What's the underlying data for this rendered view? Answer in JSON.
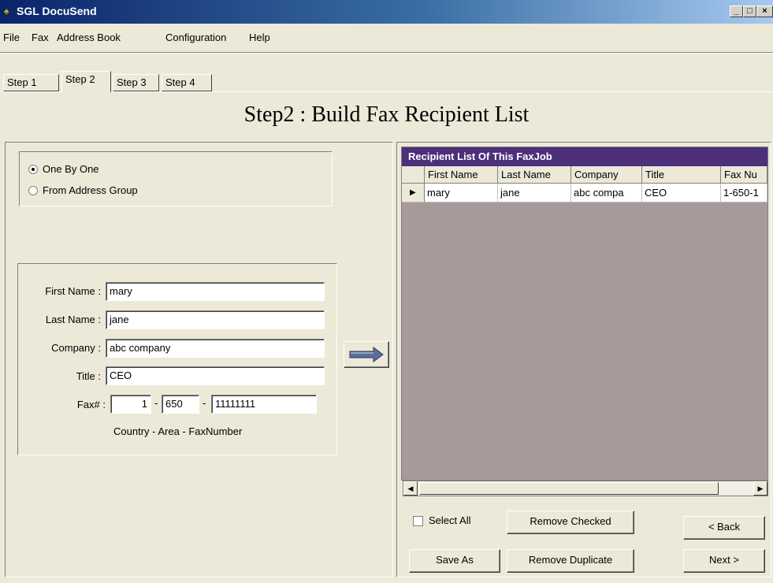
{
  "window": {
    "title": "SGL DocuSend",
    "minimize": "_",
    "maximize": "□",
    "close": "×"
  },
  "menu": [
    "File",
    "Fax",
    "Address Book",
    "Configuration",
    "Help"
  ],
  "tabs": [
    "Step 1",
    "Step 2",
    "Step 3",
    "Step 4"
  ],
  "heading": "Step2 : Build Fax Recipient List",
  "mode": {
    "one_by_one": "One By One",
    "from_group": "From Address Group",
    "selected": "One By One"
  },
  "form": {
    "first_name_label": "First Name :",
    "first_name": "mary",
    "last_name_label": "Last Name :",
    "last_name": "jane",
    "company_label": "Company :",
    "company": "abc company",
    "title_label": "Title :",
    "title": "CEO",
    "fax_label": "Fax# :",
    "fax_country": "1",
    "fax_area": "650",
    "fax_number": "11111111",
    "dash": "-",
    "fax_hint": "Country - Area - FaxNumber"
  },
  "grid": {
    "caption": "Recipient List Of This FaxJob",
    "columns": [
      "First Name",
      "Last Name",
      "Company",
      "Title",
      "Fax Nu"
    ],
    "rows": [
      [
        "mary",
        "jane",
        "abc compa",
        "CEO",
        "1-650-1"
      ]
    ]
  },
  "buttons": {
    "select_all": "Select All",
    "remove_checked": "Remove Checked",
    "back": "< Back",
    "save_as": "Save As",
    "remove_duplicate": "Remove Duplicate",
    "next": "Next >"
  }
}
